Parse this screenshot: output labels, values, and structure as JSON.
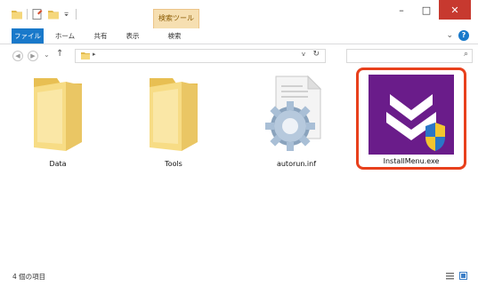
{
  "titlebar": {
    "context_tab_label": "検索ツール",
    "minimize": "–",
    "maximize": "□",
    "close": "✕"
  },
  "ribbon": {
    "tabs": [
      "ファイル",
      "ホーム",
      "共有",
      "表示",
      "検索"
    ],
    "help": "?"
  },
  "address": {
    "separator": "▸",
    "dropdown": "v",
    "refresh": "↻"
  },
  "search": {
    "icon": "search-icon",
    "glyph": "⌕"
  },
  "items": [
    {
      "name": "Data",
      "type": "folder"
    },
    {
      "name": "Tools",
      "type": "folder"
    },
    {
      "name": "autorun.inf",
      "type": "settings-file"
    },
    {
      "name": "InstallMenu.exe",
      "type": "installer",
      "selected": true
    }
  ],
  "statusbar": {
    "count": "4 個の項目"
  },
  "colors": {
    "file_tab": "#1979ca",
    "context_tab": "#f6dfb1",
    "installer_bg": "#6a1c8a",
    "highlight": "#e8401c",
    "folder": "#f5d77b"
  }
}
